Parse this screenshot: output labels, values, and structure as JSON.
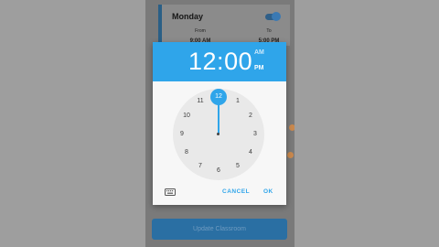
{
  "background_app": {
    "day_label": "Monday",
    "from_label": "From",
    "from_time": "9:00 AM",
    "to_label": "To",
    "to_time": "5:00 PM",
    "update_button_label": "Update Classroom"
  },
  "time_picker": {
    "hour": "12",
    "separator": ":",
    "minute": "00",
    "am_label": "AM",
    "pm_label": "PM",
    "selected_period": "PM",
    "selected_hour": "12",
    "dial_numbers": [
      "12",
      "1",
      "2",
      "3",
      "4",
      "5",
      "6",
      "7",
      "8",
      "9",
      "10",
      "11"
    ],
    "cancel_label": "CANCEL",
    "ok_label": "OK",
    "accent_color": "#2fa5ea",
    "keyboard_toggle_icon": "keyboard-icon"
  }
}
